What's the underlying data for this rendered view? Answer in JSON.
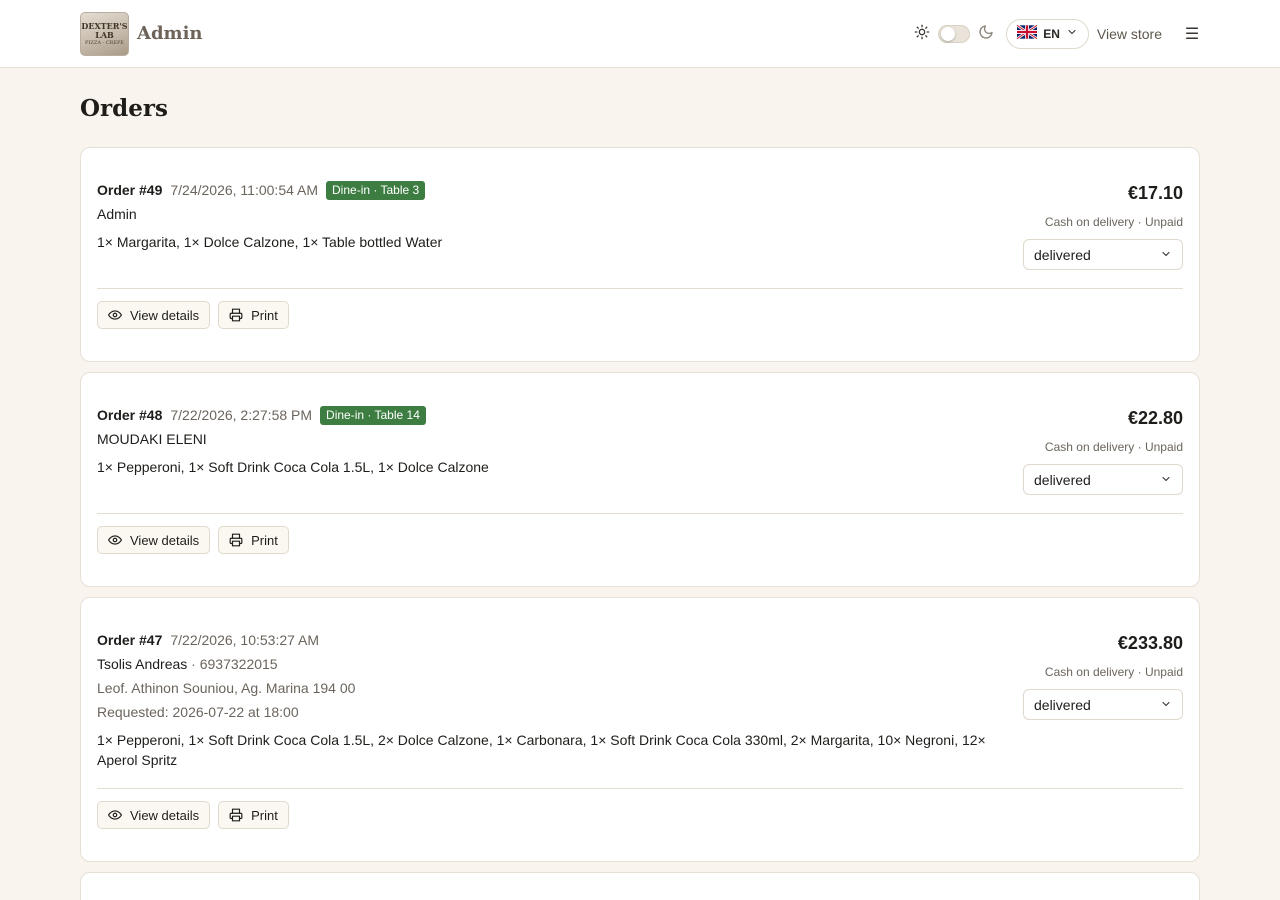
{
  "header": {
    "logo": {
      "line1": "DEXTER'S",
      "line2": "LAB",
      "sub": "PIZZA · CREPE"
    },
    "title": "Admin",
    "language": {
      "code": "EN",
      "flag": "uk-flag-icon"
    },
    "view_store_label": "View store",
    "icons": {
      "light": "sun-icon",
      "dark": "moon-icon",
      "menu": "hamburger-menu-icon"
    },
    "menu_glyph": "☰"
  },
  "page": {
    "title": "Orders"
  },
  "orders": [
    {
      "number": "Order #49",
      "date": "7/24/2026, 11:00:54 AM",
      "tag": "Dine-in · Table 3",
      "customer": "Admin",
      "items": "1× Margarita, 1× Dolce Calzone, 1× Table bottled Water",
      "total": "€17.10",
      "payment": "Cash on delivery · Unpaid",
      "status": "delivered",
      "view_label": "View details",
      "print_label": "Print"
    },
    {
      "number": "Order #48",
      "date": "7/22/2026, 2:27:58 PM",
      "tag": "Dine-in · Table 14",
      "customer": "MOUDAKI ELENI",
      "items": "1× Pepperoni, 1× Soft Drink Coca Cola 1.5L, 1× Dolce Calzone",
      "total": "€22.80",
      "payment": "Cash on delivery · Unpaid",
      "status": "delivered",
      "view_label": "View details",
      "print_label": "Print"
    },
    {
      "number": "Order #47",
      "date": "7/22/2026, 10:53:27 AM",
      "customer": "Tsolis Andreas",
      "phone": "· 6937322015",
      "address": "Leof. Athinon Souniou, Ag. Marina 194 00",
      "requested": "Requested: 2026-07-22 at 18:00",
      "items": "1× Pepperoni, 1× Soft Drink Coca Cola 1.5L, 2× Dolce Calzone, 1× Carbonara, 1× Soft Drink Coca Cola 330ml, 2× Margarita, 10× Negroni, 12× Aperol Spritz",
      "total": "€233.80",
      "payment": "Cash on delivery · Unpaid",
      "status": "delivered",
      "view_label": "View details",
      "print_label": "Print"
    }
  ],
  "colors": {
    "accent_tag": "#3d7d42",
    "background": "#f9f5ee",
    "card": "#ffffff"
  }
}
